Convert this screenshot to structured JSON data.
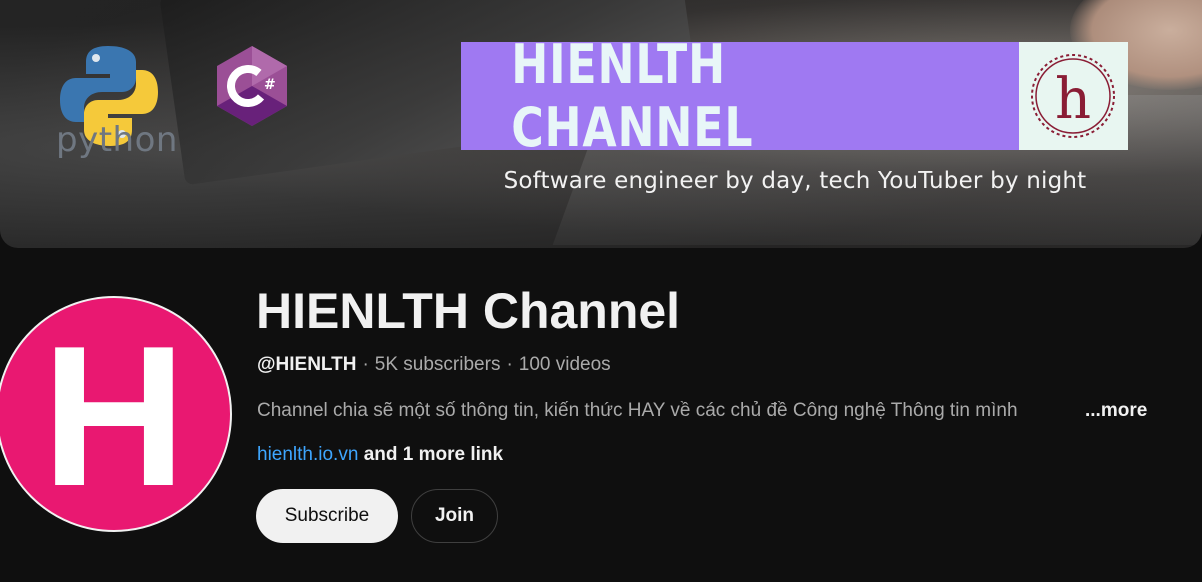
{
  "banner": {
    "python_caption": "python",
    "csharp_symbol": "C#",
    "title": "HIENLTH CHANNEL",
    "logo_letter": "h",
    "tagline": "Software engineer by day, tech YouTuber by night"
  },
  "channel": {
    "avatar_letter": "H",
    "name": "HIENLTH Channel",
    "handle": "@HIENLTH",
    "subscribers": "5K subscribers",
    "videos": "100 videos",
    "description": "Channel chia sẽ một số thông tin, kiến thức HAY về các chủ đề Công nghệ Thông tin mình",
    "more_label": "...more",
    "link": "hienlth.io.vn",
    "more_links": "and 1 more link"
  },
  "actions": {
    "subscribe_label": "Subscribe",
    "join_label": "Join"
  },
  "colors": {
    "avatar_bg": "#e91871",
    "banner_title_bg": "#9f79f2",
    "link": "#3ea6ff"
  }
}
